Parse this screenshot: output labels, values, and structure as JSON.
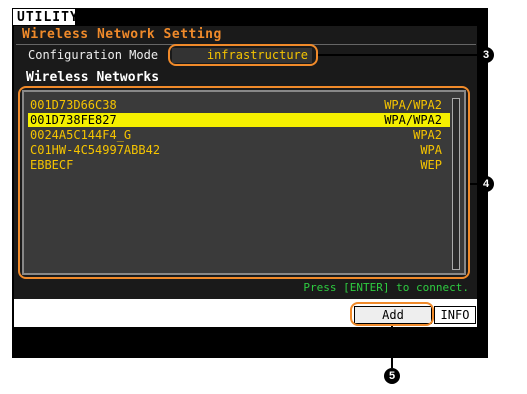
{
  "tab": {
    "label": "UTILITY"
  },
  "title": "Wireless Network Setting",
  "config": {
    "label": "Configuration Mode",
    "value": "infrastructure"
  },
  "networks_title": "Wireless Networks",
  "networks": [
    {
      "ssid": "001D73D66C38",
      "security": "WPA/WPA2"
    },
    {
      "ssid": "001D738FE827",
      "security": "WPA/WPA2",
      "selected": true
    },
    {
      "ssid": "0024A5C144F4_G",
      "security": "WPA2"
    },
    {
      "ssid": "C01HW-4C54997ABB42",
      "security": "WPA"
    },
    {
      "ssid": "EBBECF",
      "security": "WEP"
    }
  ],
  "hint": "Press [ENTER] to connect.",
  "buttons": {
    "add": "Add",
    "info": "INFO"
  },
  "callouts": [
    "3",
    "4",
    "5"
  ],
  "colors": {
    "title": "#f08a2a",
    "list_text": "#f5c400",
    "selected_bg": "#f5f000",
    "hint": "#2ecc40",
    "callout": "#f08a2a"
  }
}
